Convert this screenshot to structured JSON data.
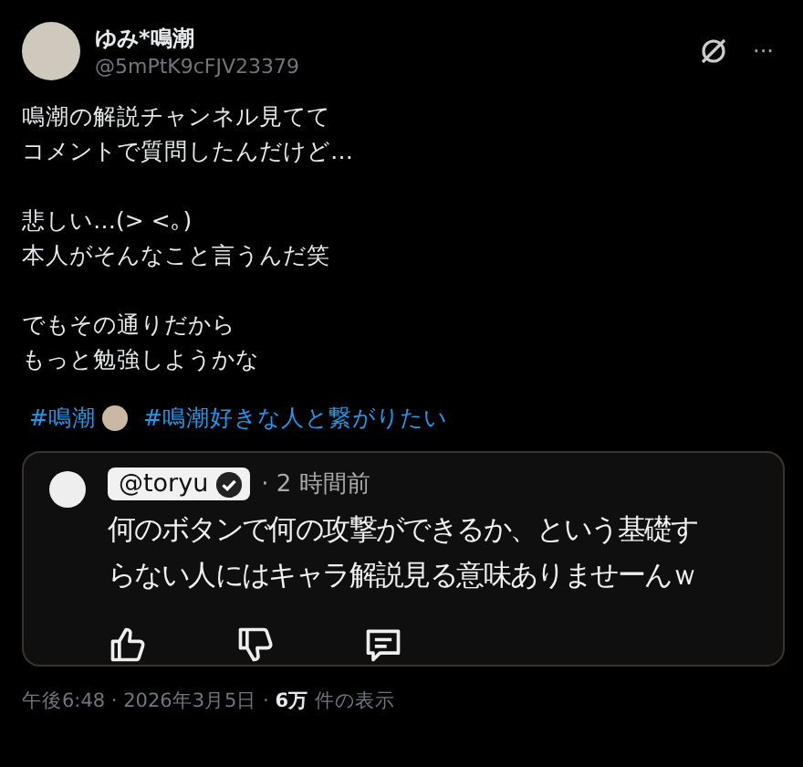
{
  "post": {
    "author": {
      "name": "ゆみ*鳴潮",
      "handle": "@5mPtK9cFJV23379"
    },
    "more": "···",
    "paragraphs": [
      [
        "鳴潮の解説チャンネル見てて",
        "コメントで質問したんだけど…"
      ],
      [
        "悲しい…(> <｡)",
        "本人がそんなこと言うんだ笑"
      ],
      [
        "でもその通りだから",
        "もっと勉強しようかな"
      ]
    ],
    "hashtags": [
      "#鳴潮",
      "#鳴潮好きな人と繋がりたい"
    ],
    "embedded_comment": {
      "handle": "@toryu",
      "verified": true,
      "time": "· 2 時間前",
      "lines": [
        "何のボタンで何の攻撃ができるか、という基礎す",
        "らない人にはキャラ解説見る意味ありませーんｗ"
      ]
    },
    "meta": "午後6:48 · 2026年3月5日 · **6万** 件の表示"
  }
}
